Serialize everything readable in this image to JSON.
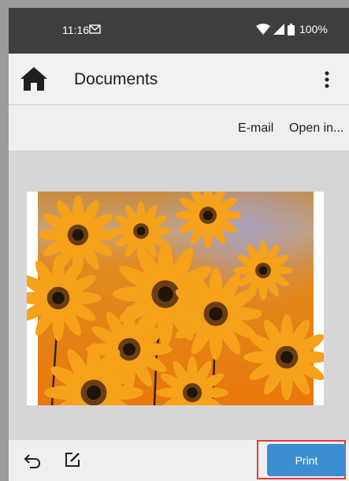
{
  "status_bar": {
    "time": "11:16",
    "battery": "100%"
  },
  "app_bar": {
    "title": "Documents"
  },
  "actions": {
    "email_label": "E-mail",
    "open_label": "Open in..."
  },
  "bottom_bar": {
    "print_label": "Print"
  },
  "icons": {
    "status": [
      "gmail-icon",
      "wifi-icon",
      "signal-icon",
      "battery-icon"
    ],
    "app_bar": [
      "home-icon",
      "overflow-menu-icon"
    ],
    "bottom_bar": [
      "undo-icon",
      "edit-icon"
    ]
  },
  "colors": {
    "print_button": "#3d8ecf",
    "highlight": "#e4393d",
    "status_bar": "#3e3e3e"
  }
}
